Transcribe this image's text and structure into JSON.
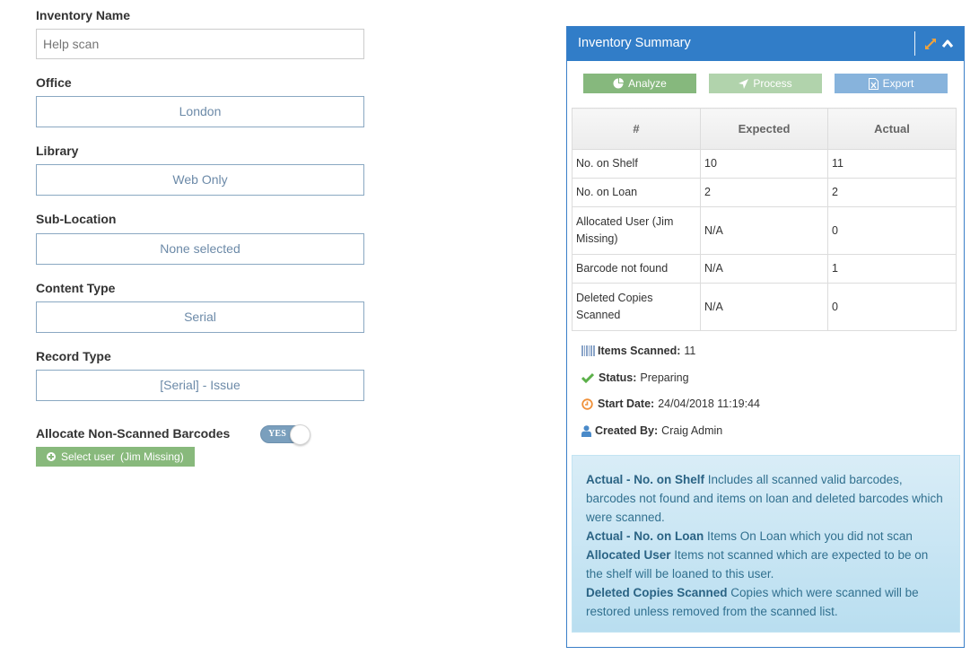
{
  "form": {
    "inventory_name": {
      "label": "Inventory Name",
      "value": "",
      "placeholder": "Help scan"
    },
    "office": {
      "label": "Office",
      "value": "London"
    },
    "library": {
      "label": "Library",
      "value": "Web Only"
    },
    "sub_location": {
      "label": "Sub-Location",
      "value": "None selected"
    },
    "content_type": {
      "label": "Content Type",
      "value": "Serial"
    },
    "record_type": {
      "label": "Record Type",
      "value": "[Serial] - Issue"
    },
    "allocate": {
      "label": "Allocate Non-Scanned Barcodes",
      "toggle_text": "YES",
      "toggle_on": true,
      "select_user_label": "Select user",
      "selected_user": "(Jim Missing)"
    }
  },
  "panel": {
    "title": "Inventory Summary",
    "icons": {
      "expand": "expand-arrows-icon",
      "collapse": "chevron-up-icon"
    },
    "buttons": [
      {
        "label": "Analyze",
        "icon": "pie-chart-icon"
      },
      {
        "label": "Process",
        "icon": "location-arrow-icon"
      },
      {
        "label": "Export",
        "icon": "excel-file-icon"
      }
    ],
    "table": {
      "headers": [
        "#",
        "Expected",
        "Actual"
      ],
      "rows": [
        {
          "name": "No. on Shelf",
          "expected": "10",
          "actual": "11"
        },
        {
          "name": "No. on Loan",
          "expected": "2",
          "actual": "2"
        },
        {
          "name": "Allocated User (Jim Missing)",
          "expected": "N/A",
          "actual": "0"
        },
        {
          "name": "Barcode not found",
          "expected": "N/A",
          "actual": "1"
        },
        {
          "name": "Deleted Copies Scanned",
          "expected": "N/A",
          "actual": "0"
        }
      ]
    },
    "info": {
      "items_scanned": {
        "label": "Items Scanned:",
        "value": "11",
        "icon": "barcode-icon"
      },
      "status": {
        "label": "Status:",
        "value": "Preparing",
        "icon": "check-icon"
      },
      "start_date": {
        "label": "Start Date:",
        "value": "24/04/2018 11:19:44",
        "icon": "clock-icon"
      },
      "created_by": {
        "label": "Created By:",
        "value": "Craig Admin",
        "icon": "user-icon"
      }
    },
    "help": [
      {
        "term": "Actual - No. on Shelf",
        "text": " Includes all scanned valid barcodes, barcodes not found and items on loan and deleted barcodes which were scanned."
      },
      {
        "term": "Actual - No. on Loan",
        "text": " Items On Loan which you did not scan"
      },
      {
        "term": "Allocated User",
        "text": " Items not scanned which are expected to be on the shelf will be loaned to this user."
      },
      {
        "term": "Deleted Copies Scanned",
        "text": " Copies which were scanned will be restored unless removed from the scanned list."
      }
    ],
    "colors": {
      "header": "#317dc8",
      "analyze": "#86b87d",
      "process": "#b1d3ac",
      "export": "#87b3dc",
      "help_bg": "#d9edf7",
      "help_text": "#31708f"
    }
  }
}
